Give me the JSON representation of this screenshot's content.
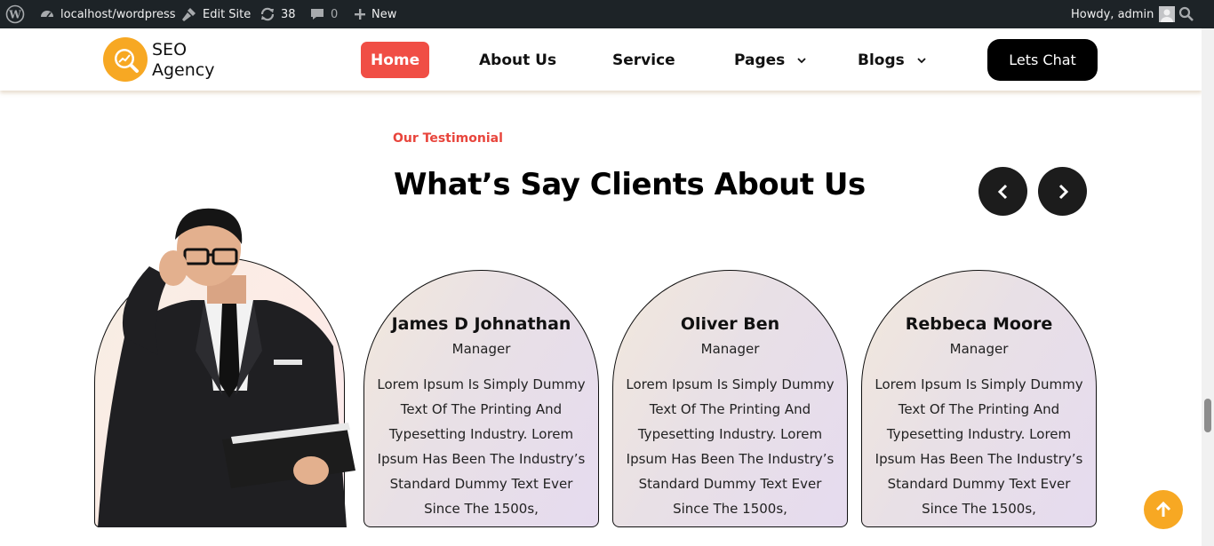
{
  "adminbar": {
    "site": "localhost/wordpress",
    "edit": "Edit Site",
    "updates": "38",
    "comments": "0",
    "new": "New",
    "howdy": "Howdy, admin"
  },
  "header": {
    "logo_line1": "SEO",
    "logo_line2": "Agency",
    "nav": {
      "home": "Home",
      "about": "About Us",
      "service": "Service",
      "pages": "Pages",
      "blogs": "Blogs"
    },
    "cta": "Lets Chat"
  },
  "section": {
    "eyebrow": "Our Testimonial",
    "title": "What’s Say Clients About Us"
  },
  "testimonials": [
    {
      "name": "James D Johnathan",
      "role": "Manager",
      "quote": "Lorem Ipsum Is Simply Dummy Text Of The Printing And Typesetting Industry. Lorem Ipsum Has Been The Industry’s Standard Dummy Text Ever Since The 1500s,"
    },
    {
      "name": "Oliver Ben",
      "role": "Manager",
      "quote": "Lorem Ipsum Is Simply Dummy Text Of The Printing And Typesetting Industry. Lorem Ipsum Has Been The Industry’s Standard Dummy Text Ever Since The 1500s,"
    },
    {
      "name": "Rebbeca Moore",
      "role": "Manager",
      "quote": "Lorem Ipsum Is Simply Dummy Text Of The Printing And Typesetting Industry. Lorem Ipsum Has Been The Industry’s Standard Dummy Text Ever Since The 1500s,"
    }
  ],
  "colors": {
    "accent": "#f04e45",
    "brand_orange": "#f7a823",
    "dark": "#1c1c1c"
  },
  "icons": {
    "wp": "wordpress-icon",
    "dashboard": "dashboard-icon",
    "edit": "brush-icon",
    "updates": "refresh-icon",
    "comments": "comment-icon",
    "new": "plus-icon",
    "avatar": "avatar-icon",
    "search": "search-icon",
    "prev": "chevron-left-icon",
    "next": "chevron-right-icon",
    "totop": "arrow-up-icon"
  }
}
